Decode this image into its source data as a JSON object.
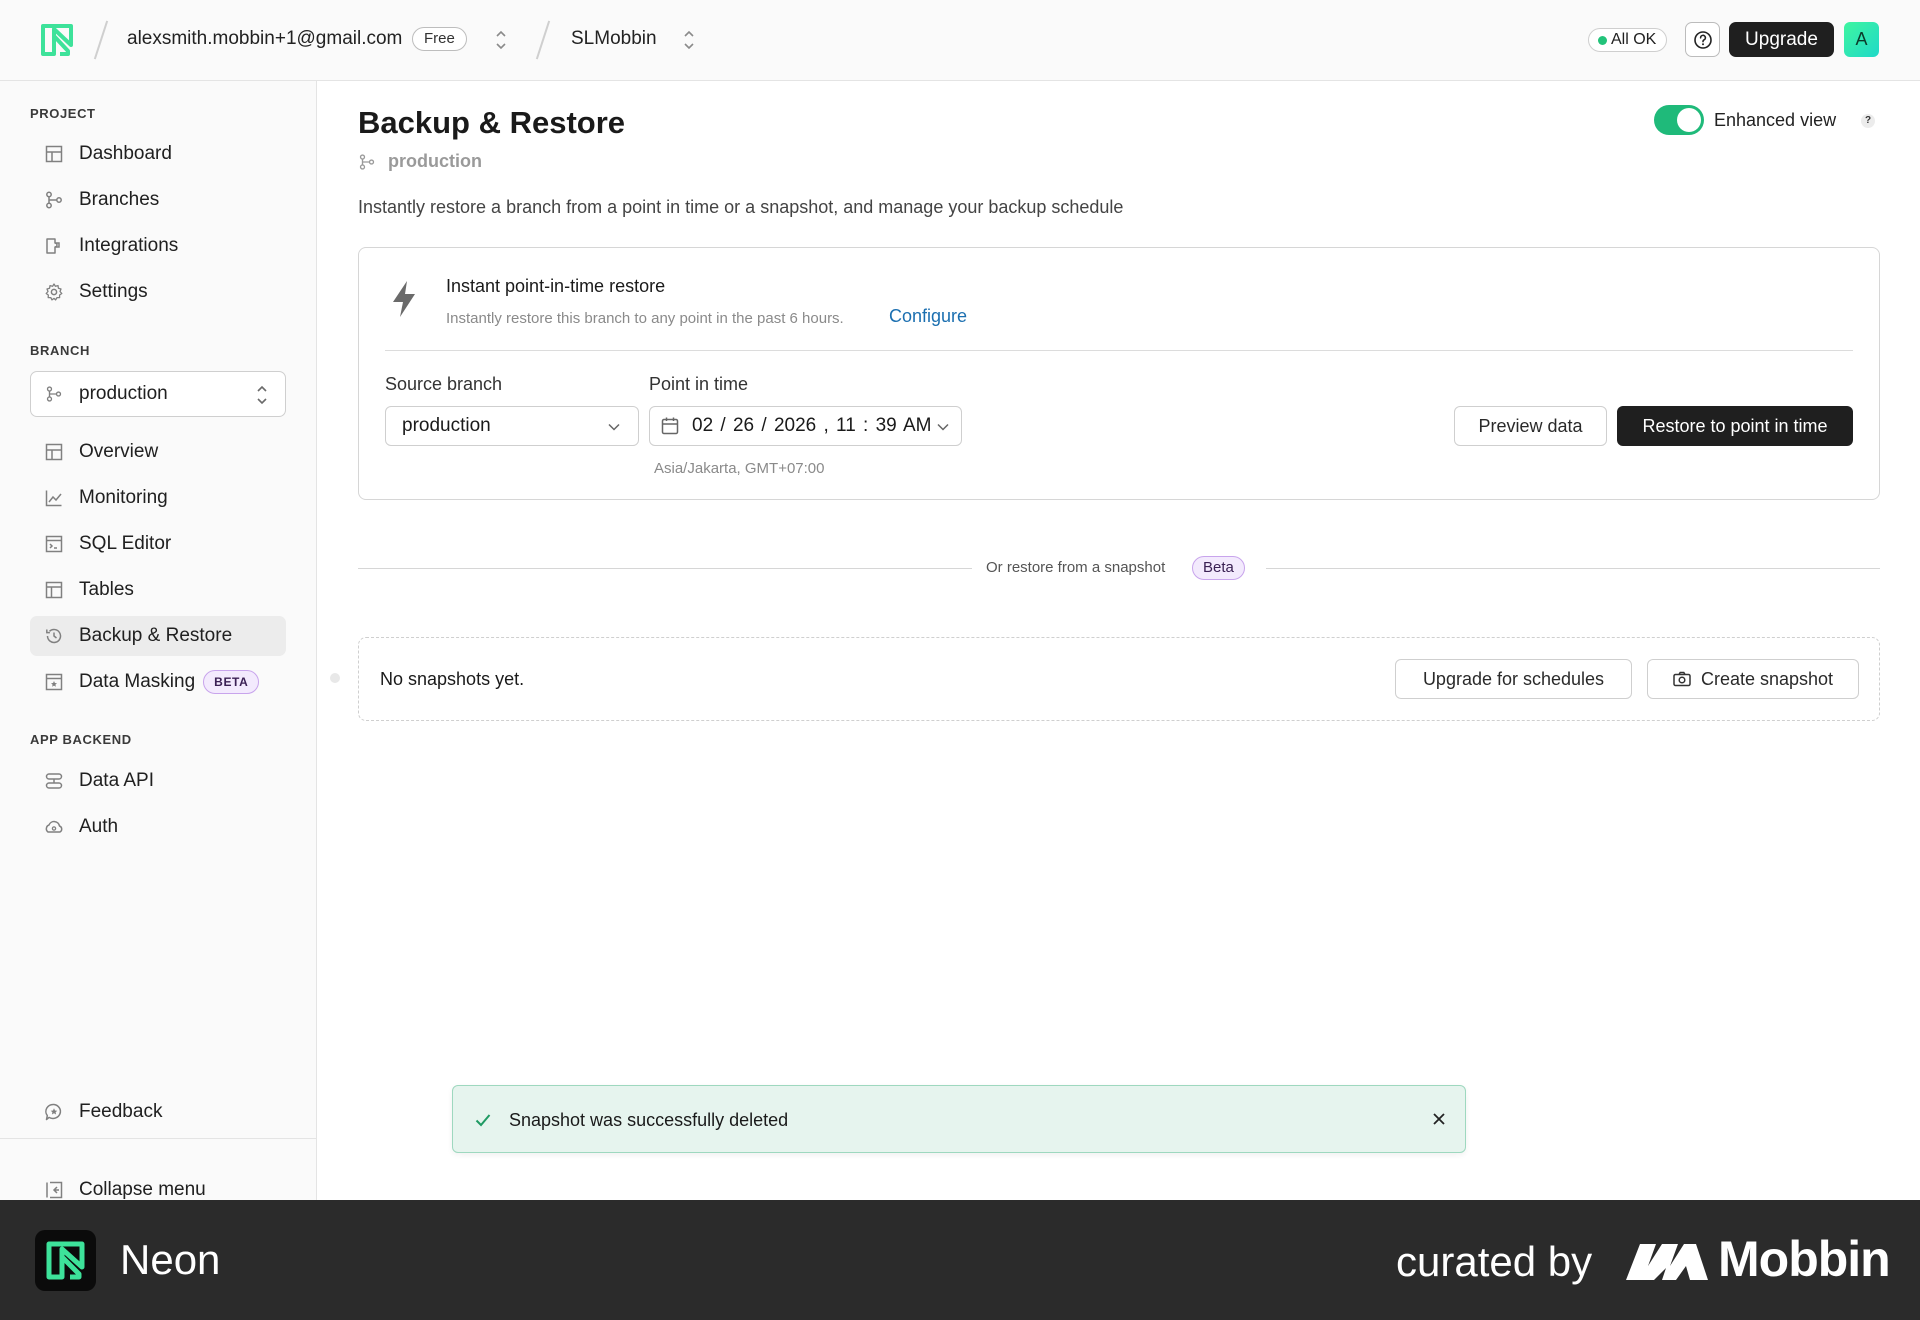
{
  "topbar": {
    "account_email": "alexsmith.mobbin+1@gmail.com",
    "plan_badge": "Free",
    "project_name": "SLMobbin",
    "status_label": "All OK",
    "upgrade_label": "Upgrade",
    "avatar_initial": "A"
  },
  "sidebar": {
    "project_section": "PROJECT",
    "project_items": [
      {
        "label": "Dashboard",
        "icon": "dashboard-icon"
      },
      {
        "label": "Branches",
        "icon": "branches-icon"
      },
      {
        "label": "Integrations",
        "icon": "integrations-icon"
      },
      {
        "label": "Settings",
        "icon": "gear-icon"
      }
    ],
    "branch_section": "BRANCH",
    "branch_selected": "production",
    "branch_items": [
      {
        "label": "Overview",
        "icon": "overview-icon"
      },
      {
        "label": "Monitoring",
        "icon": "monitoring-icon"
      },
      {
        "label": "SQL Editor",
        "icon": "sql-editor-icon"
      },
      {
        "label": "Tables",
        "icon": "tables-icon"
      },
      {
        "label": "Backup & Restore",
        "icon": "history-icon",
        "active": true
      },
      {
        "label": "Data Masking",
        "icon": "data-masking-icon",
        "badge": "BETA"
      }
    ],
    "backend_section": "APP BACKEND",
    "backend_items": [
      {
        "label": "Data API",
        "icon": "data-api-icon"
      },
      {
        "label": "Auth",
        "icon": "auth-icon"
      }
    ],
    "feedback_label": "Feedback",
    "collapse_label": "Collapse menu"
  },
  "page": {
    "title": "Backup & Restore",
    "branch": "production",
    "description": "Instantly restore a branch from a point in time or a snapshot, and manage your backup schedule",
    "enhanced_view_label": "Enhanced view",
    "enhanced_view_on": true,
    "help_glyph": "?"
  },
  "pitr": {
    "title": "Instant point-in-time restore",
    "subtitle": "Instantly restore this branch to any point in the past 6 hours.",
    "configure_label": "Configure",
    "source_branch_label": "Source branch",
    "source_branch_value": "production",
    "point_in_time_label": "Point in time",
    "point_in_time_value": "02 / 26 / 2026 ,  11 : 39  AM",
    "timezone": "Asia/Jakarta, GMT+07:00",
    "preview_label": "Preview data",
    "restore_label": "Restore to point in time"
  },
  "snapshots": {
    "divider_text": "Or restore from a snapshot",
    "divider_badge": "Beta",
    "empty_text": "No snapshots yet.",
    "upgrade_label": "Upgrade for schedules",
    "create_label": "Create snapshot"
  },
  "toast": {
    "message": "Snapshot was successfully deleted"
  },
  "footer": {
    "app_name": "Neon",
    "curated_by": "curated by",
    "brand": "Mobbin"
  },
  "colors": {
    "accent_green": "#1fba7a",
    "neon_logo_green": "#3de29a",
    "link_blue": "#1b6fb0",
    "toast_bg": "#e6f4ee"
  }
}
